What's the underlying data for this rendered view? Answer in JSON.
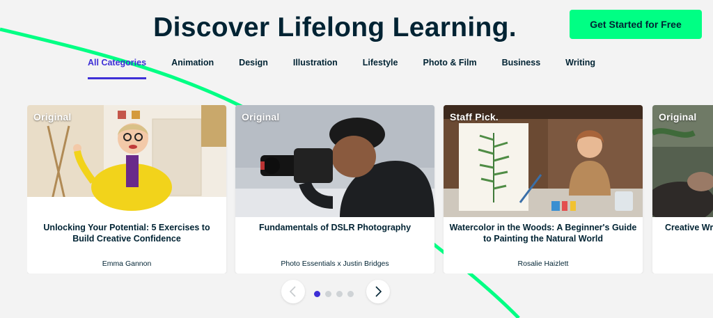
{
  "headline": "Discover Lifelong Learning.",
  "cta_label": "Get Started for Free",
  "tabs": [
    {
      "label": "All Categories",
      "active": true
    },
    {
      "label": "Animation",
      "active": false
    },
    {
      "label": "Design",
      "active": false
    },
    {
      "label": "Illustration",
      "active": false
    },
    {
      "label": "Lifestyle",
      "active": false
    },
    {
      "label": "Photo & Film",
      "active": false
    },
    {
      "label": "Business",
      "active": false
    },
    {
      "label": "Writing",
      "active": false
    }
  ],
  "cards": [
    {
      "badge": "Original",
      "title": "Unlocking Your Potential: 5 Exercises to Build Creative Confidence",
      "author": "Emma Gannon"
    },
    {
      "badge": "Original",
      "title": "Fundamentals of DSLR Photography",
      "author": "Photo Essentials x Justin Bridges"
    },
    {
      "badge": "Staff Pick.",
      "title": "Watercolor in the Woods: A Beginner's Guide to Painting the Natural World",
      "author": "Rosalie Haizlett"
    },
    {
      "badge": "Original",
      "title": "Creative Wr",
      "author": ""
    }
  ],
  "pager": {
    "prev_icon": "chevron-left-icon",
    "next_icon": "chevron-right-icon",
    "dot_count": 4,
    "active_dot": 1
  },
  "colors": {
    "accent": "#3d2fd6",
    "cta": "#00ff84",
    "text": "#002333",
    "background": "#f3f3f3"
  }
}
